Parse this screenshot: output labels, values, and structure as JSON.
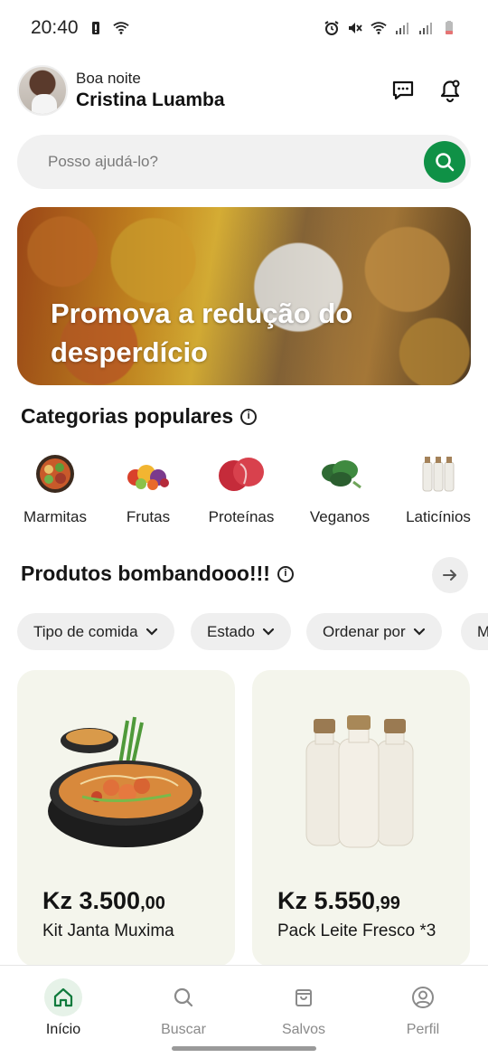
{
  "status": {
    "time": "20:40"
  },
  "header": {
    "greeting": "Boa noite",
    "user_name": "Cristina Luamba"
  },
  "search": {
    "placeholder": "Posso ajudá-lo?"
  },
  "banner": {
    "title": "Promova a redução do desperdício"
  },
  "categories": {
    "title": "Categorias populares",
    "items": [
      {
        "label": "Marmitas",
        "icon": "meal-bowl-icon"
      },
      {
        "label": "Frutas",
        "icon": "fruits-icon"
      },
      {
        "label": "Proteínas",
        "icon": "meat-icon"
      },
      {
        "label": "Veganos",
        "icon": "greens-icon"
      },
      {
        "label": "Laticínios",
        "icon": "milk-bottles-icon"
      }
    ]
  },
  "products": {
    "title": "Produtos bombandooo!!!",
    "filters": [
      "Tipo de comida",
      "Estado",
      "Ordenar por",
      "M"
    ],
    "items": [
      {
        "price_main": "Kz 3.500",
        "price_cents": ",00",
        "name": "Kit Janta Muxima"
      },
      {
        "price_main": "Kz 5.550",
        "price_cents": ",99",
        "name": "Pack Leite Fresco *3"
      }
    ]
  },
  "nav": {
    "items": [
      {
        "label": "Início",
        "icon": "home-icon",
        "active": true
      },
      {
        "label": "Buscar",
        "icon": "search-icon",
        "active": false
      },
      {
        "label": "Salvos",
        "icon": "bag-icon",
        "active": false
      },
      {
        "label": "Perfil",
        "icon": "profile-icon",
        "active": false
      }
    ]
  },
  "colors": {
    "accent": "#0f9146",
    "chip_bg": "#efefef",
    "card_bg": "#f4f5ec"
  }
}
